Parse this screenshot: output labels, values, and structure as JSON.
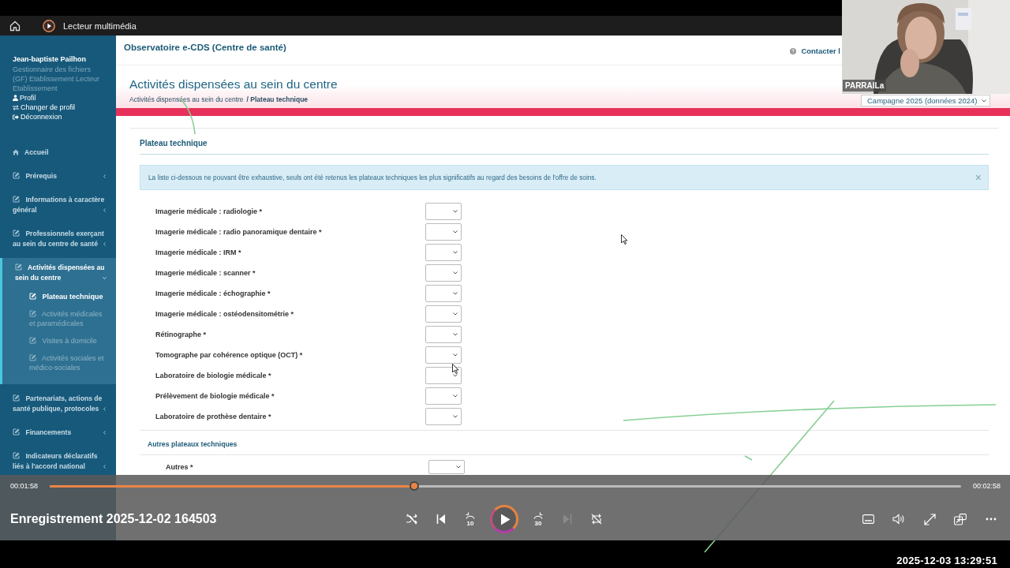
{
  "player": {
    "app_title": "Lecteur multimédia",
    "recording_title": "Enregistrement 2025-12-02 164503",
    "elapsed": "00:01:58",
    "duration": "00:02:58",
    "level": 0.4,
    "playing": false,
    "skip_back": "10",
    "skip_forward": "30",
    "next_disabled": true,
    "timestamp": "2025-12-03 13:29:51"
  },
  "webcam": {
    "kind": "picture",
    "name": "PARRAILa"
  },
  "site": {
    "title": "Observatoire e-CDS (Centre de santé)",
    "contact": "Contacter l",
    "user": {
      "name": "Jean-baptiste Pailhon",
      "role": "Gestionnaire des fichiers (GF) Etablissement Lecteur Etablissement",
      "links": [
        "Profil",
        "Changer de profil",
        "Déconnexion"
      ]
    },
    "menu": [
      {
        "label": "Accueil",
        "kind": "link",
        "expanded": false,
        "selected": false
      },
      {
        "label": "Prérequis",
        "kind": "section",
        "expanded": false,
        "selected": false
      },
      {
        "label": "Informations à caractère général",
        "kind": "section",
        "expanded": false,
        "selected": false
      },
      {
        "label": "Professionnels exerçant au sein du centre de santé",
        "kind": "section",
        "expanded": false,
        "selected": false
      },
      {
        "label": "Activités dispensées au sein du centre",
        "kind": "section",
        "expanded": true,
        "selected": true,
        "children": [
          {
            "label": "Plateau technique",
            "selected": true
          },
          {
            "label": "Activités médicales et paramédicales",
            "selected": false
          },
          {
            "label": "Visites à domicile",
            "selected": false
          },
          {
            "label": "Activités sociales et médico-sociales",
            "selected": false
          }
        ]
      },
      {
        "label": "Partenariats, actions de santé publique, protocoles",
        "kind": "section",
        "expanded": false,
        "selected": false
      },
      {
        "label": "Financements",
        "kind": "section",
        "expanded": false,
        "selected": false
      },
      {
        "label": "Indicateurs déclaratifs liés à l'accord national",
        "kind": "section",
        "expanded": false,
        "selected": false
      }
    ],
    "page_title": "Activités dispensées au sein du centre",
    "breadcrumb": [
      "Activités dispensées au sein du centre",
      "/ Plateau technique"
    ],
    "campaign": "Campagne 2025 (données 2024)",
    "section_title": "Plateau technique",
    "alert": "La liste ci-dessous ne pouvant être exhaustive, seuls ont été retenus les plateaux techniques les plus significatifs au regard des besoins de l'offre de soins.",
    "alert_close": "×",
    "fields": [
      {
        "label": "Imagerie médicale : radiologie *"
      },
      {
        "label": "Imagerie médicale : radio panoramique dentaire *"
      },
      {
        "label": "Imagerie médicale : IRM *"
      },
      {
        "label": "Imagerie médicale : scanner *"
      },
      {
        "label": "Imagerie médicale : échographie *"
      },
      {
        "label": "Imagerie médicale : ostéodensitométrie *"
      },
      {
        "label": "Rétinographe *"
      },
      {
        "label": "Tomographe par cohérence optique (OCT) *"
      },
      {
        "label": "Laboratoire de biologie médicale *"
      },
      {
        "label": "Prélèvement de biologie médicale *"
      },
      {
        "label": "Laboratoire de prothèse dentaire *"
      }
    ],
    "other_title": "Autres plateaux techniques",
    "other_fields": [
      {
        "label": "Autres *"
      }
    ]
  }
}
